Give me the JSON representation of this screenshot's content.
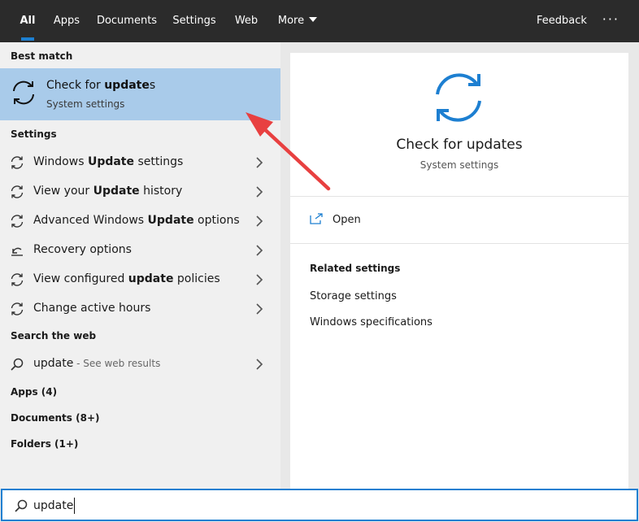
{
  "tabs": [
    {
      "label": "All",
      "active": true
    },
    {
      "label": "Apps"
    },
    {
      "label": "Documents"
    },
    {
      "label": "Settings"
    },
    {
      "label": "Web"
    },
    {
      "label": "More"
    }
  ],
  "topbar": {
    "feedback_label": "Feedback",
    "more_options": "···"
  },
  "left": {
    "best_match_heading": "Best match",
    "best_match": {
      "title_prefix": "Check for ",
      "title_bold": "update",
      "title_suffix": "s",
      "subtitle": "System settings"
    },
    "settings_heading": "Settings",
    "settings_items": [
      {
        "pre": "Windows ",
        "bold": "Update",
        "post": " settings",
        "icon": "refresh-icon"
      },
      {
        "pre": "View your ",
        "bold": "Update",
        "post": " history",
        "icon": "refresh-icon"
      },
      {
        "pre": "Advanced Windows ",
        "bold": "Update",
        "post": " options",
        "icon": "refresh-icon"
      },
      {
        "pre": "Recovery options",
        "bold": "",
        "post": "",
        "icon": "recovery-icon"
      },
      {
        "pre": "View configured ",
        "bold": "update",
        "post": " policies",
        "icon": "refresh-icon"
      },
      {
        "pre": "Change active hours",
        "bold": "",
        "post": "",
        "icon": "refresh-icon"
      }
    ],
    "web_heading": "Search the web",
    "web_item": {
      "query": "update",
      "suffix": " - See web results"
    },
    "apps_heading": "Apps (4)",
    "documents_heading": "Documents (8+)",
    "folders_heading": "Folders (1+)"
  },
  "right": {
    "title": "Check for updates",
    "subtitle": "System settings",
    "open_label": "Open",
    "related_heading": "Related settings",
    "related_links": [
      "Storage settings",
      "Windows specifications"
    ]
  },
  "search": {
    "value": "update"
  },
  "colors": {
    "accent": "#1d7fd1",
    "highlight": "#a9cbea",
    "annotation_arrow": "#e84040",
    "topbar": "#2b2b2b"
  }
}
